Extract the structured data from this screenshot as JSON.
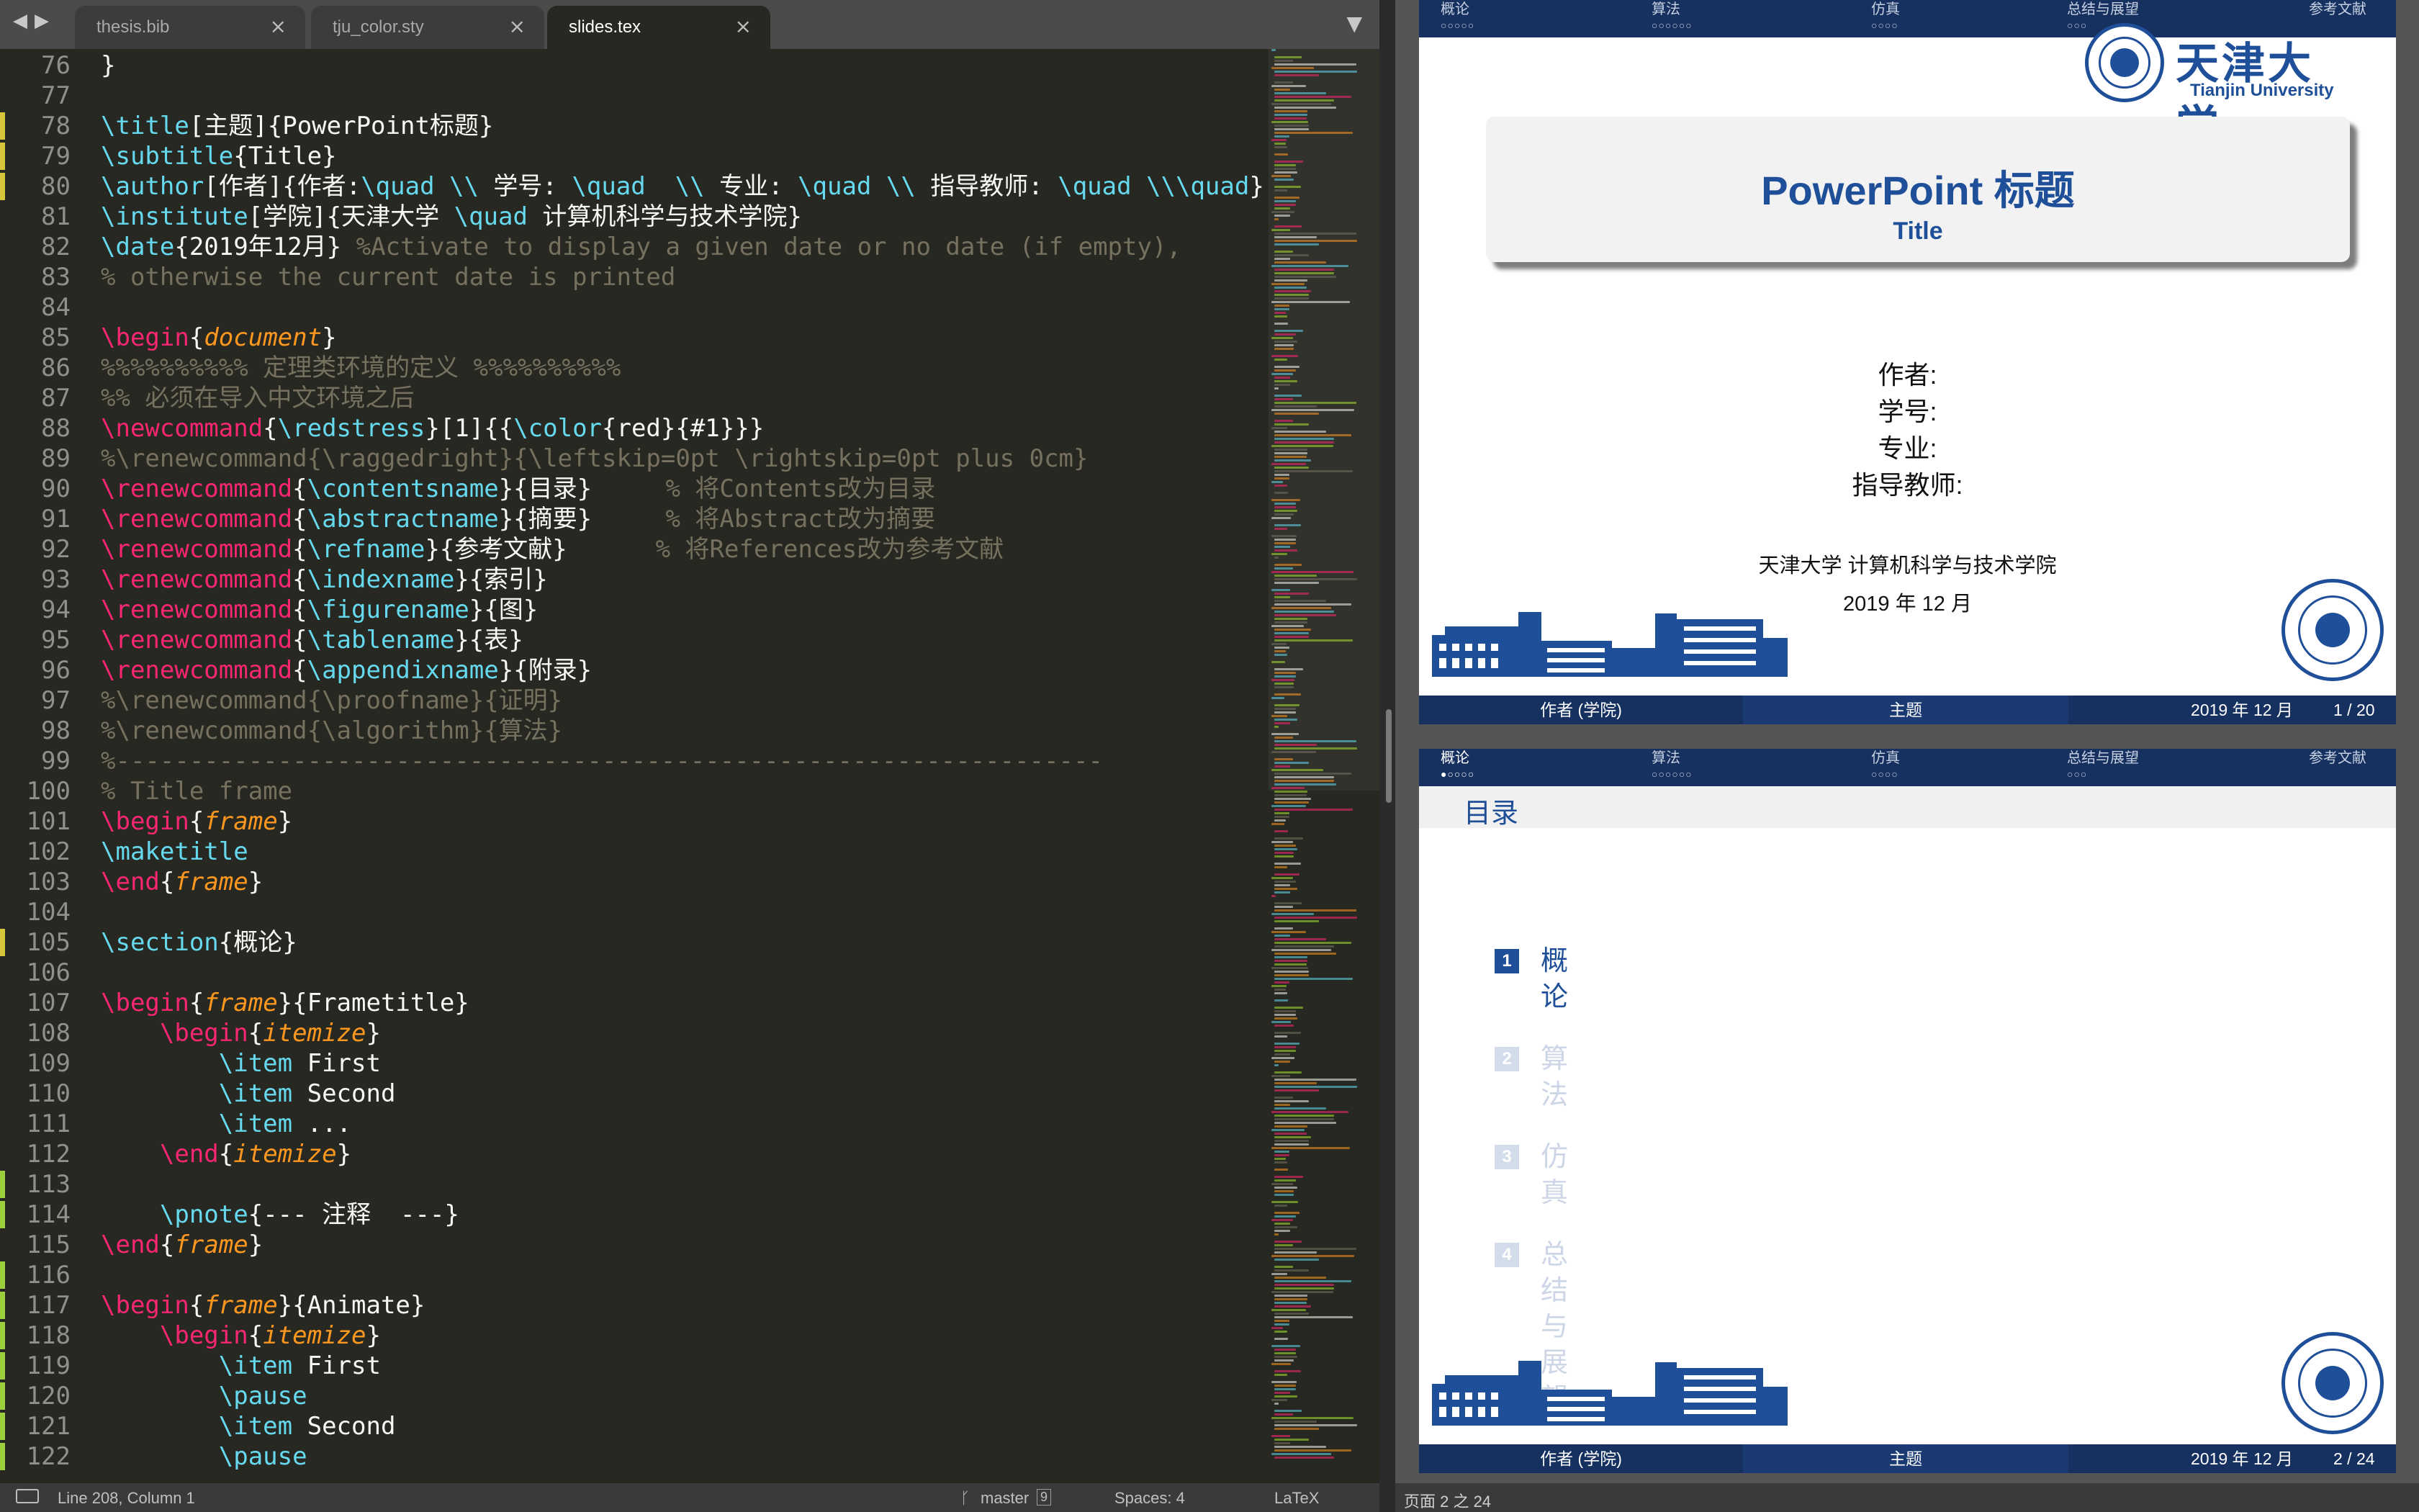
{
  "editor": {
    "tabs": [
      {
        "label": "thesis.bib",
        "active": false
      },
      {
        "label": "tju_color.sty",
        "active": false
      },
      {
        "label": "slides.tex",
        "active": true
      }
    ],
    "lines": [
      {
        "n": "76",
        "mark": "",
        "tokens": [
          [
            "p",
            "}"
          ]
        ]
      },
      {
        "n": "77",
        "mark": "",
        "tokens": []
      },
      {
        "n": "78",
        "mark": "yellow",
        "tokens": [
          [
            "c",
            "\\title"
          ],
          [
            "p",
            "[主题]{PowerPoint标题}"
          ]
        ]
      },
      {
        "n": "79",
        "mark": "yellow",
        "tokens": [
          [
            "c",
            "\\subtitle"
          ],
          [
            "p",
            "{Title}"
          ]
        ]
      },
      {
        "n": "80",
        "mark": "yellow",
        "tokens": [
          [
            "c",
            "\\author"
          ],
          [
            "p",
            "[作者]{作者:"
          ],
          [
            "c",
            "\\quad \\\\"
          ],
          [
            "p",
            " 学号: "
          ],
          [
            "c",
            "\\quad  \\\\"
          ],
          [
            "p",
            " 专业: "
          ],
          [
            "c",
            "\\quad \\\\"
          ],
          [
            "p",
            " 指导教师: "
          ],
          [
            "c",
            "\\quad \\\\\\quad"
          ],
          [
            "p",
            "}"
          ]
        ]
      },
      {
        "n": "81",
        "mark": "",
        "tokens": [
          [
            "c",
            "\\institute"
          ],
          [
            "p",
            "[学院]{天津大学 "
          ],
          [
            "c",
            "\\quad"
          ],
          [
            "p",
            " 计算机科学与技术学院}"
          ]
        ]
      },
      {
        "n": "82",
        "mark": "",
        "tokens": [
          [
            "c",
            "\\date"
          ],
          [
            "p",
            "{2019年12月} "
          ],
          [
            "m",
            "%Activate to display a given date or no date (if empty),"
          ]
        ]
      },
      {
        "n": "83",
        "mark": "",
        "tokens": [
          [
            "m",
            "% otherwise the current date is printed"
          ]
        ]
      },
      {
        "n": "84",
        "mark": "",
        "tokens": []
      },
      {
        "n": "85",
        "mark": "",
        "tokens": [
          [
            "k",
            "\\begin"
          ],
          [
            "p",
            "{"
          ],
          [
            "e",
            "document"
          ],
          [
            "p",
            "}"
          ]
        ]
      },
      {
        "n": "86",
        "mark": "",
        "tokens": [
          [
            "m",
            "%%%%%%%%%% 定理类环境的定义 %%%%%%%%%%"
          ]
        ]
      },
      {
        "n": "87",
        "mark": "",
        "tokens": [
          [
            "m",
            "%% 必须在导入中文环境之后"
          ]
        ]
      },
      {
        "n": "88",
        "mark": "",
        "tokens": [
          [
            "k",
            "\\newcommand"
          ],
          [
            "p",
            "{"
          ],
          [
            "c",
            "\\redstress"
          ],
          [
            "p",
            "}[1]{{"
          ],
          [
            "c",
            "\\color"
          ],
          [
            "p",
            "{red}{#1}}}"
          ]
        ]
      },
      {
        "n": "89",
        "mark": "",
        "tokens": [
          [
            "m",
            "%\\renewcommand{\\raggedright}{\\leftskip=0pt \\rightskip=0pt plus 0cm}"
          ]
        ]
      },
      {
        "n": "90",
        "mark": "",
        "tokens": [
          [
            "k",
            "\\renewcommand"
          ],
          [
            "p",
            "{"
          ],
          [
            "c",
            "\\contentsname"
          ],
          [
            "p",
            "}{目录}     "
          ],
          [
            "m",
            "% 将Contents改为目录"
          ]
        ]
      },
      {
        "n": "91",
        "mark": "",
        "tokens": [
          [
            "k",
            "\\renewcommand"
          ],
          [
            "p",
            "{"
          ],
          [
            "c",
            "\\abstractname"
          ],
          [
            "p",
            "}{摘要}     "
          ],
          [
            "m",
            "% 将Abstract改为摘要"
          ]
        ]
      },
      {
        "n": "92",
        "mark": "",
        "tokens": [
          [
            "k",
            "\\renewcommand"
          ],
          [
            "p",
            "{"
          ],
          [
            "c",
            "\\refname"
          ],
          [
            "p",
            "}{参考文献}      "
          ],
          [
            "m",
            "% 将References改为参考文献"
          ]
        ]
      },
      {
        "n": "93",
        "mark": "",
        "tokens": [
          [
            "k",
            "\\renewcommand"
          ],
          [
            "p",
            "{"
          ],
          [
            "c",
            "\\indexname"
          ],
          [
            "p",
            "}{索引}"
          ]
        ]
      },
      {
        "n": "94",
        "mark": "",
        "tokens": [
          [
            "k",
            "\\renewcommand"
          ],
          [
            "p",
            "{"
          ],
          [
            "c",
            "\\figurename"
          ],
          [
            "p",
            "}{图}"
          ]
        ]
      },
      {
        "n": "95",
        "mark": "",
        "tokens": [
          [
            "k",
            "\\renewcommand"
          ],
          [
            "p",
            "{"
          ],
          [
            "c",
            "\\tablename"
          ],
          [
            "p",
            "}{表}"
          ]
        ]
      },
      {
        "n": "96",
        "mark": "",
        "tokens": [
          [
            "k",
            "\\renewcommand"
          ],
          [
            "p",
            "{"
          ],
          [
            "c",
            "\\appendixname"
          ],
          [
            "p",
            "}{附录}"
          ]
        ]
      },
      {
        "n": "97",
        "mark": "",
        "tokens": [
          [
            "m",
            "%\\renewcommand{\\proofname}{证明}"
          ]
        ]
      },
      {
        "n": "98",
        "mark": "",
        "tokens": [
          [
            "m",
            "%\\renewcommand{\\algorithm}{算法}"
          ]
        ]
      },
      {
        "n": "99",
        "mark": "",
        "tokens": [
          [
            "m",
            "%-------------------------------------------------------------------"
          ]
        ]
      },
      {
        "n": "100",
        "mark": "",
        "tokens": [
          [
            "m",
            "% Title frame"
          ]
        ]
      },
      {
        "n": "101",
        "mark": "",
        "tokens": [
          [
            "k",
            "\\begin"
          ],
          [
            "p",
            "{"
          ],
          [
            "e",
            "frame"
          ],
          [
            "p",
            "}"
          ]
        ]
      },
      {
        "n": "102",
        "mark": "",
        "tokens": [
          [
            "c",
            "\\maketitle"
          ]
        ]
      },
      {
        "n": "103",
        "mark": "",
        "tokens": [
          [
            "k",
            "\\end"
          ],
          [
            "p",
            "{"
          ],
          [
            "e",
            "frame"
          ],
          [
            "p",
            "}"
          ]
        ]
      },
      {
        "n": "104",
        "mark": "",
        "tokens": []
      },
      {
        "n": "105",
        "mark": "yellow",
        "tokens": [
          [
            "c",
            "\\section"
          ],
          [
            "p",
            "{概论}"
          ]
        ]
      },
      {
        "n": "106",
        "mark": "",
        "tokens": []
      },
      {
        "n": "107",
        "mark": "",
        "tokens": [
          [
            "k",
            "\\begin"
          ],
          [
            "p",
            "{"
          ],
          [
            "e",
            "frame"
          ],
          [
            "p",
            "}{Frametitle}"
          ]
        ]
      },
      {
        "n": "108",
        "mark": "",
        "tokens": [
          [
            "p",
            "    "
          ],
          [
            "k",
            "\\begin"
          ],
          [
            "p",
            "{"
          ],
          [
            "e",
            "itemize"
          ],
          [
            "p",
            "}"
          ]
        ]
      },
      {
        "n": "109",
        "mark": "",
        "tokens": [
          [
            "p",
            "        "
          ],
          [
            "c",
            "\\item"
          ],
          [
            "p",
            " First"
          ]
        ]
      },
      {
        "n": "110",
        "mark": "",
        "tokens": [
          [
            "p",
            "        "
          ],
          [
            "c",
            "\\item"
          ],
          [
            "p",
            " Second"
          ]
        ]
      },
      {
        "n": "111",
        "mark": "",
        "tokens": [
          [
            "p",
            "        "
          ],
          [
            "c",
            "\\item"
          ],
          [
            "p",
            " ..."
          ]
        ]
      },
      {
        "n": "112",
        "mark": "",
        "tokens": [
          [
            "p",
            "    "
          ],
          [
            "k",
            "\\end"
          ],
          [
            "p",
            "{"
          ],
          [
            "e",
            "itemize"
          ],
          [
            "p",
            "}"
          ]
        ]
      },
      {
        "n": "113",
        "mark": "green",
        "tokens": []
      },
      {
        "n": "114",
        "mark": "green",
        "tokens": [
          [
            "p",
            "    "
          ],
          [
            "c",
            "\\pnote"
          ],
          [
            "p",
            "{--- 注释  ---}"
          ]
        ]
      },
      {
        "n": "115",
        "mark": "",
        "tokens": [
          [
            "k",
            "\\end"
          ],
          [
            "p",
            "{"
          ],
          [
            "e",
            "frame"
          ],
          [
            "p",
            "}"
          ]
        ]
      },
      {
        "n": "116",
        "mark": "green",
        "tokens": []
      },
      {
        "n": "117",
        "mark": "green",
        "tokens": [
          [
            "k",
            "\\begin"
          ],
          [
            "p",
            "{"
          ],
          [
            "e",
            "frame"
          ],
          [
            "p",
            "}{Animate}"
          ]
        ]
      },
      {
        "n": "118",
        "mark": "green",
        "tokens": [
          [
            "p",
            "    "
          ],
          [
            "k",
            "\\begin"
          ],
          [
            "p",
            "{"
          ],
          [
            "e",
            "itemize"
          ],
          [
            "p",
            "}"
          ]
        ]
      },
      {
        "n": "119",
        "mark": "green",
        "tokens": [
          [
            "p",
            "        "
          ],
          [
            "c",
            "\\item"
          ],
          [
            "p",
            " First"
          ]
        ]
      },
      {
        "n": "120",
        "mark": "green",
        "tokens": [
          [
            "p",
            "        "
          ],
          [
            "c",
            "\\pause"
          ]
        ]
      },
      {
        "n": "121",
        "mark": "green",
        "tokens": [
          [
            "p",
            "        "
          ],
          [
            "c",
            "\\item"
          ],
          [
            "p",
            " Second"
          ]
        ]
      },
      {
        "n": "122",
        "mark": "green",
        "tokens": [
          [
            "p",
            "        "
          ],
          [
            "c",
            "\\pause"
          ]
        ]
      }
    ],
    "status": {
      "position": "Line 208, Column 1",
      "branch": "master",
      "branch_count": "9",
      "spaces": "Spaces: 4",
      "syntax": "LaTeX"
    },
    "colors": {
      "keyword": "#f92672",
      "command": "#66d9ef",
      "environment": "#fd971f",
      "comment": "#75715e",
      "background": "#272822"
    }
  },
  "viewer": {
    "nav_sections": [
      {
        "label": "概论",
        "dots": "○○○○○"
      },
      {
        "label": "算法",
        "dots": "○○○○○○"
      },
      {
        "label": "仿真",
        "dots": "○○○○"
      },
      {
        "label": "总结与展望",
        "dots": "○○○"
      },
      {
        "label": "参考文献",
        "dots": ""
      }
    ],
    "slide1": {
      "title": "PowerPoint 标题",
      "subtitle": "Title",
      "author_lines": [
        "作者:",
        "学号:",
        "专业:",
        "指导教师:"
      ],
      "institute": "天津大学     计算机科学与技术学院",
      "date": "2019 年 12 月",
      "logo_cn": "天津大学",
      "logo_en": "Tianjin University",
      "foot_author": "作者 (学院)",
      "foot_title": "主题",
      "foot_date": "2019 年 12 月",
      "foot_page": "1 / 20",
      "nav_dots_first": "○○○○○"
    },
    "slide2": {
      "frametitle": "目录",
      "nav_dots_first": "●○○○○",
      "toc": [
        {
          "num": "1",
          "label": "概论",
          "current": true
        },
        {
          "num": "2",
          "label": "算法",
          "current": false
        },
        {
          "num": "3",
          "label": "仿真",
          "current": false
        },
        {
          "num": "4",
          "label": "总结与展望",
          "current": false
        }
      ],
      "foot_author": "作者 (学院)",
      "foot_title": "主题",
      "foot_date": "2019 年 12 月",
      "foot_page": "2 / 24"
    },
    "page_status": "页面 2 之 24",
    "colors": {
      "tju_blue": "#1f4f98",
      "nav_bar": "#16305f"
    }
  }
}
